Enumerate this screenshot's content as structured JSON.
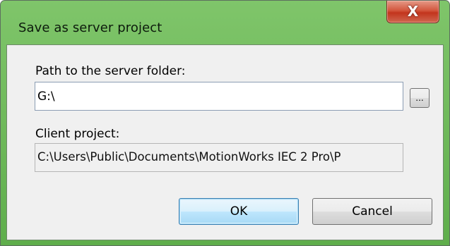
{
  "window": {
    "title": "Save as server project",
    "close_label": "X"
  },
  "form": {
    "path_label": "Path to the server folder:",
    "path_value": "G:\\",
    "browse_label": "...",
    "client_label": "Client project:",
    "client_value": "C:\\Users\\Public\\Documents\\MotionWorks IEC 2 Pro\\P"
  },
  "buttons": {
    "ok_label": "OK",
    "cancel_label": "Cancel"
  },
  "colors": {
    "frame_green": "#6bb958",
    "close_red": "#c9452b",
    "default_button_border": "#3c7fb1"
  },
  "icons": {
    "close": "close-icon"
  }
}
